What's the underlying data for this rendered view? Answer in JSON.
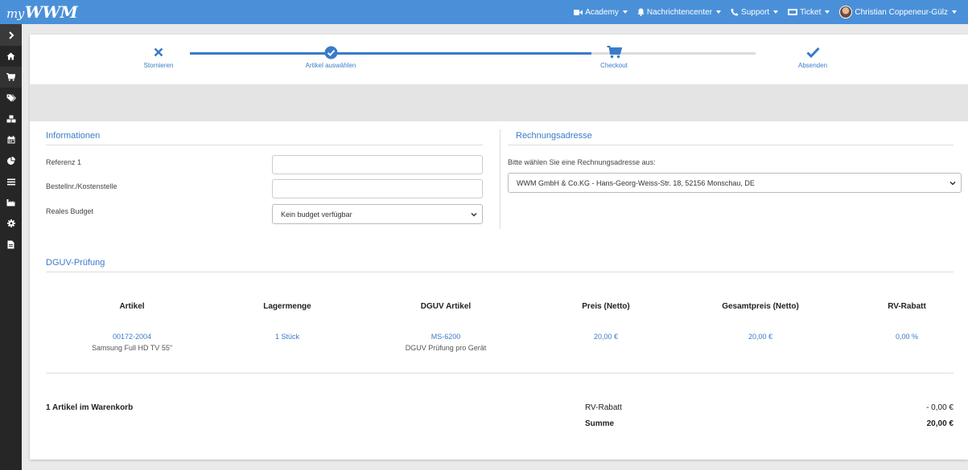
{
  "app": {
    "logo_prefix": "my",
    "logo_main": "WWM"
  },
  "topnav": {
    "academy": "Academy",
    "messages": "Nachrichtencenter",
    "support": "Support",
    "ticket": "Ticket",
    "user": "Christian Coppeneur-Gülz"
  },
  "steps": [
    {
      "label": "Stornieren",
      "icon": "close-icon"
    },
    {
      "label": "Artikel auswählen",
      "icon": "check-circle-icon"
    },
    {
      "label": "Checkout",
      "icon": "cart-icon"
    },
    {
      "label": "Absenden",
      "icon": "check-icon"
    }
  ],
  "progress": {
    "completed_fraction": 0.71
  },
  "informationen": {
    "title": "Informationen",
    "referenz_label": "Referenz 1",
    "referenz_value": "",
    "bestellnr_label": "Bestellnr./Kostenstelle",
    "bestellnr_value": "",
    "budget_label": "Reales Budget",
    "budget_selected": "Kein budget verfügbar"
  },
  "rechnungsadresse": {
    "title": "Rechnungsadresse",
    "prompt": "Bitte wählen Sie eine Rechnungsadresse aus:",
    "selected": "WWM GmbH & Co.KG - Hans-Georg-Weiss-Str. 18, 52156 Monschau, DE"
  },
  "dguv": {
    "title": "DGUV-Prüfung",
    "columns": [
      "Artikel",
      "Lagermenge",
      "DGUV Artikel",
      "Preis (Netto)",
      "Gesamtpreis (Netto)",
      "RV-Rabatt"
    ],
    "row": {
      "artikel_nr": "00172-2004",
      "artikel_name": "Samsung Full HD TV 55\"",
      "lagermenge": "1 Stück",
      "dguv_nr": "MS-6200",
      "dguv_name": "DGUV Prüfung pro Gerät",
      "preis": "20,00 €",
      "gesamtpreis": "20,00 €",
      "rabatt": "0,00 %"
    }
  },
  "summary": {
    "count": "1 Artikel im Warenkorb",
    "rabatt_label": "RV-Rabatt",
    "rabatt_value": "- 0,00 €",
    "summe_label": "Summe",
    "summe_value": "20,00 €"
  },
  "colors": {
    "topbar": "#4a90d9",
    "accent": "#3a7bc8",
    "sidebar": "#262626"
  }
}
